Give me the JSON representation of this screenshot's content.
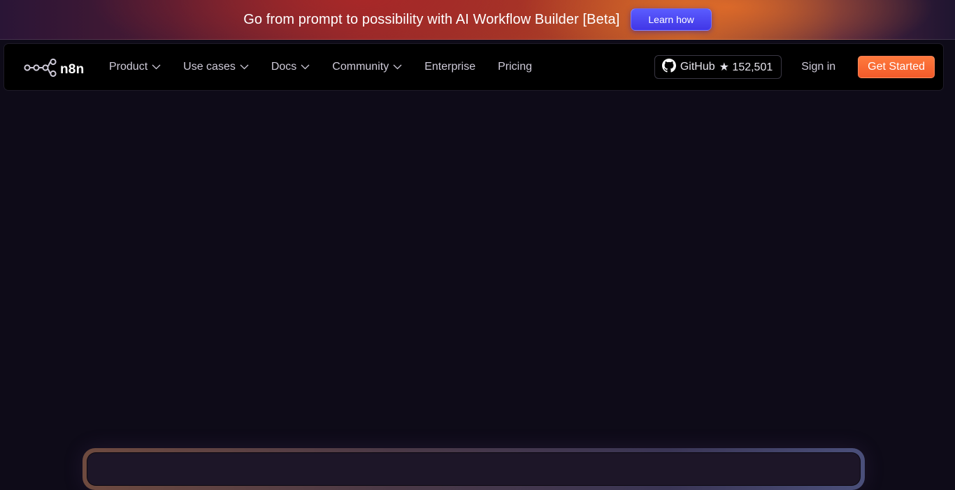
{
  "banner": {
    "text": "Go from prompt to possibility with AI Workflow Builder [Beta]",
    "button_label": "Learn how"
  },
  "logo": {
    "text": "n8n",
    "icon": "n8n-logo-icon"
  },
  "nav": {
    "items": [
      {
        "label": "Product",
        "has_dropdown": true
      },
      {
        "label": "Use cases",
        "has_dropdown": true
      },
      {
        "label": "Docs",
        "has_dropdown": true
      },
      {
        "label": "Community",
        "has_dropdown": true
      },
      {
        "label": "Enterprise",
        "has_dropdown": false
      },
      {
        "label": "Pricing",
        "has_dropdown": false
      }
    ]
  },
  "github": {
    "label": "GitHub",
    "stars": "★ 152,501",
    "icon": "github-icon"
  },
  "auth": {
    "signin_label": "Sign in",
    "get_started_label": "Get Started"
  },
  "colors": {
    "background": "#0e0b18",
    "cta_orange": "#f25a2a",
    "learn_button_blue": "#4136e6",
    "navbar": "#000000"
  }
}
